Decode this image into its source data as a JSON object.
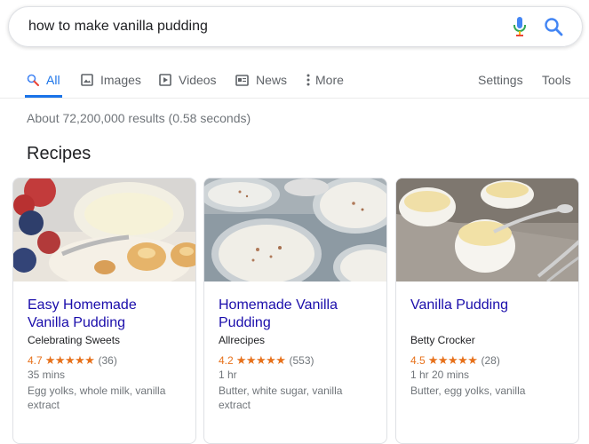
{
  "search": {
    "query": "how to make vanilla pudding"
  },
  "tabs": [
    {
      "label": "All"
    },
    {
      "label": "Images"
    },
    {
      "label": "Videos"
    },
    {
      "label": "News"
    },
    {
      "label": "More"
    }
  ],
  "tools": {
    "settings": "Settings",
    "tools": "Tools"
  },
  "result_stats": "About 72,200,000 results (0.58 seconds)",
  "section_title": "Recipes",
  "recipes": [
    {
      "title": "Easy Homemade Vanilla Pudding",
      "source": "Celebrating Sweets",
      "rating": "4.7",
      "stars": "★★★★★",
      "reviews": "(36)",
      "time": "35 mins",
      "ingredients": "Egg yolks, whole milk, vanilla extract"
    },
    {
      "title": "Homemade Vanilla Pudding",
      "source": "Allrecipes",
      "rating": "4.2",
      "stars": "★★★★★",
      "reviews": "(553)",
      "time": "1 hr",
      "ingredients": "Butter, white sugar, vanilla extract"
    },
    {
      "title": "Vanilla Pudding",
      "source": "Betty Crocker",
      "rating": "4.5",
      "stars": "★★★★★",
      "reviews": "(28)",
      "time": "1 hr 20 mins",
      "ingredients": "Butter, egg yolks, vanilla"
    }
  ],
  "colors": {
    "accent": "#1a73e8",
    "link": "#1a0dab",
    "star": "#e7711b"
  }
}
